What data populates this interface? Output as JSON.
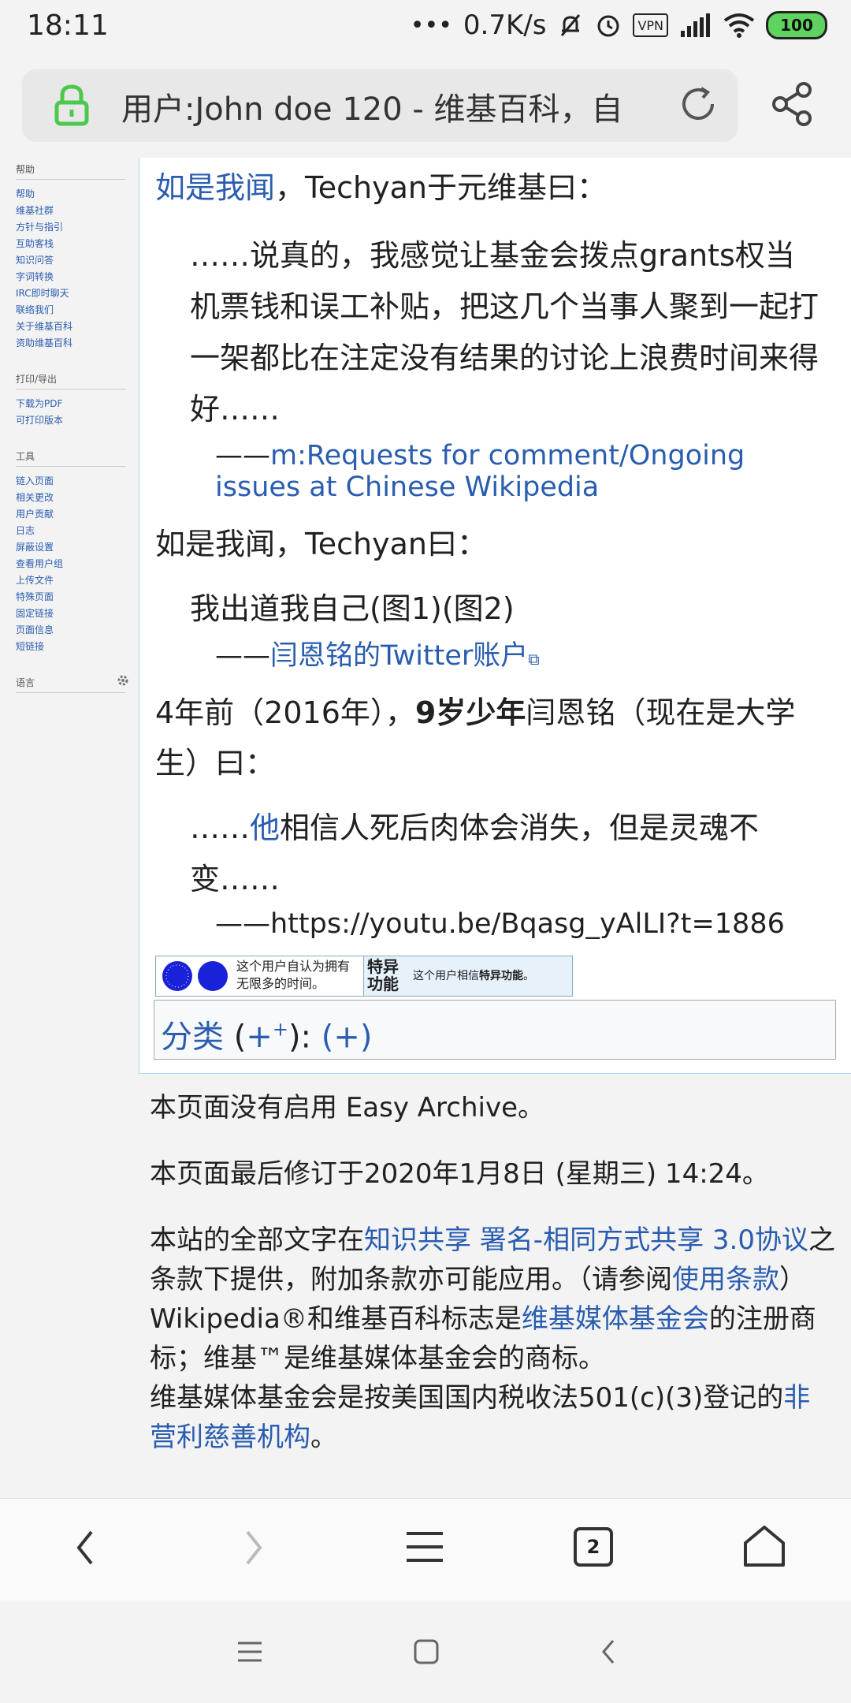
{
  "status": {
    "time": "18:11",
    "dots": "•••",
    "speed": "0.7K/s",
    "vpn": "VPN",
    "battery": "100"
  },
  "address": {
    "title": "用户:John doe 120 - 维基百科，自"
  },
  "sidebar": {
    "groups": [
      {
        "title": "帮助",
        "items": [
          "帮助",
          "维基社群",
          "方针与指引",
          "互助客栈",
          "知识问答",
          "字词转换",
          "IRC即时聊天",
          "联络我们",
          "关于维基百科",
          "资助维基百科"
        ]
      },
      {
        "title": "打印/导出",
        "items": [
          "下载为PDF",
          "可打印版本"
        ]
      },
      {
        "title": "工具",
        "items": [
          "链入页面",
          "相关更改",
          "用户贡献",
          "日志",
          "屏蔽设置",
          "查看用户组",
          "上传文件",
          "特殊页面",
          "固定链接",
          "页面信息",
          "短链接"
        ]
      },
      {
        "title": "语言",
        "items": []
      }
    ]
  },
  "content": {
    "p1_link": "如是我闻",
    "p1_text": "，Techyan于元维基曰：",
    "q1": "……说真的，我感觉让基金会拨点grants权当机票钱和误工补贴，把这几个当事人聚到一起打一架都比在注定没有结果的讨论上浪费时间来得好……",
    "q1_dash": "——",
    "q1_src": "m:Requests for comment/Ongoing issues at Chinese Wikipedia",
    "p2": "如是我闻，Techyan曰：",
    "q2": "我出道我自己(图1)(图2)",
    "q2_dash": "——",
    "q2_src": "闫恩铭的Twitter账户",
    "p3_a": "4年前（2016年），",
    "p3_b": "9岁少年",
    "p3_c": "闫恩铭（现在是大学生）曰：",
    "q3_a": "……",
    "q3_link": "他",
    "q3_b": "相信人死后肉体会消失，但是灵魂不变……",
    "q3_src": "——https://youtu.be/Bqasg_yAlLI?t=1886",
    "ub1_text": "这个用户自认为拥有无限多的时间。",
    "ub2_label": "特异功能",
    "ub2_text_a": "这个用户相信",
    "ub2_text_b": "特异功能",
    "ub2_text_c": "。",
    "cat_label": "分类",
    "cat_rest_a": " (",
    "cat_plus_sup": "+",
    "cat_rest_b": "): ",
    "cat_plus2": "(+)"
  },
  "footer": {
    "line1": "本页面没有启用 Easy Archive。",
    "line2": "本页面最后修订于2020年1月8日 (星期三) 14:24。",
    "l3_a": "本站的全部文字在",
    "l3_link": "知识共享 署名-相同方式共享 3.0协议",
    "l3_b": "之条款下提供，附加条款亦可能应用。（请参阅",
    "l3_link2": "使用条款",
    "l3_c": "）",
    "l4_a": "Wikipedia®和维基百科标志是",
    "l4_link": "维基媒体基金会",
    "l4_b": "的注册商标；维基™是维基媒体基金会的商标。",
    "l5_a": "维基媒体基金会是按美国国内税收法501(c)(3)登记的",
    "l5_link": "非营利慈善机构",
    "l5_b": "。"
  },
  "navbar": {
    "tabs_count": "2"
  },
  "colors": {
    "link": "#2a5db0",
    "battery": "#5fd35f",
    "lock": "#4cc94c"
  }
}
